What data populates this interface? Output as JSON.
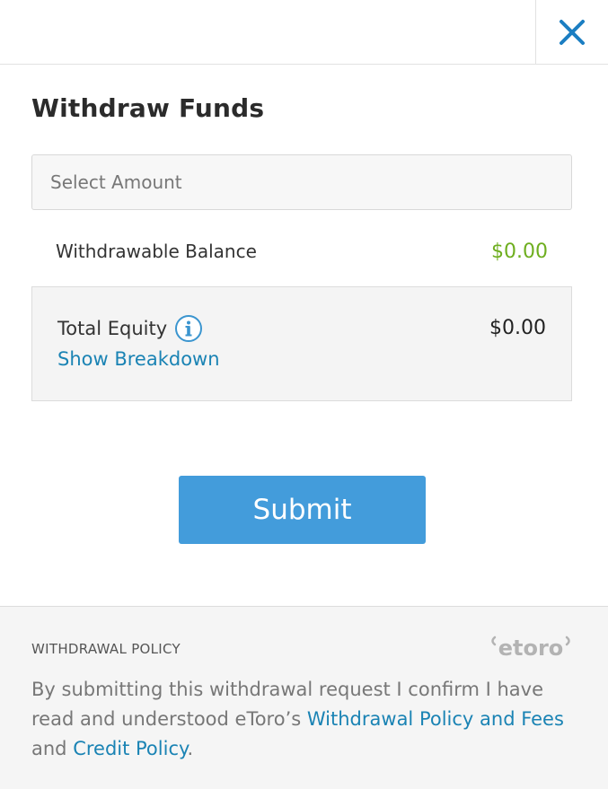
{
  "header": {
    "close_icon": "close-icon",
    "accent_color": "#1b7ec2"
  },
  "title": "Withdraw Funds",
  "amount": {
    "value": "",
    "placeholder": "Select Amount"
  },
  "balance": {
    "label": "Withdrawable Balance",
    "value": "$0.00",
    "value_color": "#6eae1f"
  },
  "equity": {
    "label": "Total Equity",
    "info_icon": "info-icon",
    "value": "$0.00",
    "breakdown_link": "Show Breakdown"
  },
  "submit_label": "Submit",
  "submit_color": "#439cdb",
  "footer": {
    "policy_title": "WITHDRAWAL POLICY",
    "logo_text": "etoro",
    "text_1": "By submitting this withdrawal request I confirm I have read and understood eToro’s ",
    "link_1": "Withdrawal Policy and Fees",
    "text_2": " and ",
    "link_2": "Credit Policy",
    "text_3": "."
  }
}
